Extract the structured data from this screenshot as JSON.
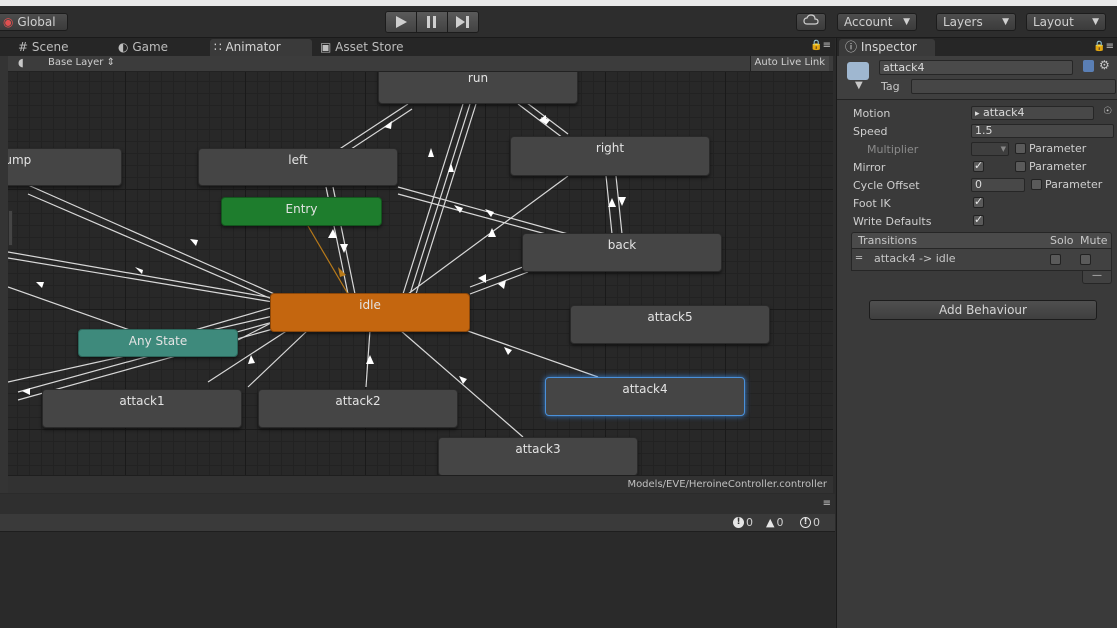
{
  "toolbar": {
    "global_label": "Global",
    "account_label": "Account",
    "layers_label": "Layers",
    "layout_label": "Layout"
  },
  "tabs": [
    {
      "label": "Scene"
    },
    {
      "label": "Game"
    },
    {
      "label": "Animator"
    },
    {
      "label": "Asset Store"
    }
  ],
  "animator": {
    "layer_label": "Base Layer",
    "live_link_label": "Auto Live Link",
    "controller_path": "Models/EVE/HeroineController.controller",
    "states": {
      "run": "run",
      "jump": "jump",
      "left": "left",
      "right": "right",
      "entry": "Entry",
      "back": "back",
      "idle": "idle",
      "attack5": "attack5",
      "any_state": "Any State",
      "attack1": "attack1",
      "attack2": "attack2",
      "attack4": "attack4",
      "attack3": "attack3"
    }
  },
  "console": {
    "error_count": "0",
    "warning_count": "0",
    "info_count": "0"
  },
  "inspector": {
    "tab_label": "Inspector",
    "state_name": "attack4",
    "tag_label": "Tag",
    "motion_label": "Motion",
    "motion_value": "attack4",
    "speed_label": "Speed",
    "speed_value": "1.5",
    "multiplier_label": "Multiplier",
    "mirror_label": "Mirror",
    "cycle_offset_label": "Cycle Offset",
    "cycle_offset_value": "0",
    "foot_ik_label": "Foot IK",
    "write_defaults_label": "Write Defaults",
    "parameter_label": "Parameter",
    "transitions_label": "Transitions",
    "solo_label": "Solo",
    "mute_label": "Mute",
    "transition_item": "attack4 -> idle",
    "add_behaviour_label": "Add Behaviour"
  }
}
